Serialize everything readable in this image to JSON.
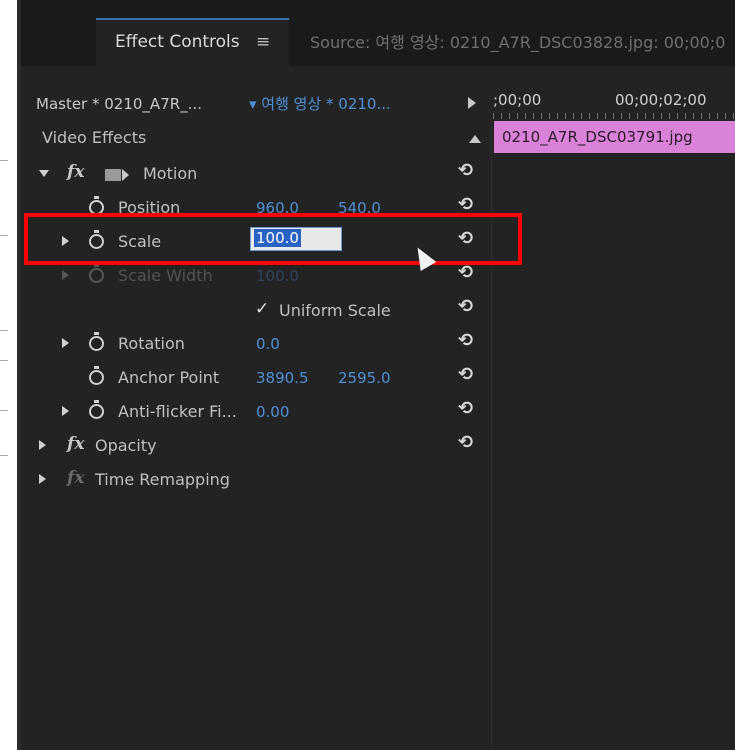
{
  "tabs": {
    "effect_controls": "Effect Controls",
    "menu_icon": "≡",
    "source": "Source: 여행 영상: 0210_A7R_DSC03828.jpg: 00;00;0"
  },
  "header": {
    "master": "Master * 0210_A7R_...",
    "clip_dropdown": "▾ 여행 영상 * 0210...",
    "time_start": ";00;00",
    "time_mark": "00;00;02;00"
  },
  "timeline": {
    "clip_name": "0210_A7R_DSC03791.jpg",
    "clip_color": "#d982d8"
  },
  "section": {
    "video_effects": "Video Effects"
  },
  "effects": {
    "motion": {
      "fx": "fx",
      "label": "Motion"
    },
    "position": {
      "label": "Position",
      "x": "960.0",
      "y": "540.0"
    },
    "scale": {
      "label": "Scale",
      "value": "100.0"
    },
    "scale_width": {
      "label": "Scale Width",
      "value": "100.0"
    },
    "uniform_scale": {
      "check": "✓",
      "label": "Uniform Scale"
    },
    "rotation": {
      "label": "Rotation",
      "value": "0.0"
    },
    "anchor_point": {
      "label": "Anchor Point",
      "x": "3890.5",
      "y": "2595.0"
    },
    "anti_flicker": {
      "label": "Anti-flicker Fi...",
      "value": "0.00"
    },
    "opacity": {
      "fx": "fx",
      "label": "Opacity"
    },
    "time_remapping": {
      "fx": "fx",
      "label": "Time Remapping"
    }
  },
  "icons": {
    "reset": "⟲"
  },
  "colors": {
    "accent_blue": "#4f8fd6",
    "highlight_red": "#ff0000",
    "selection": "#2a63c4"
  }
}
